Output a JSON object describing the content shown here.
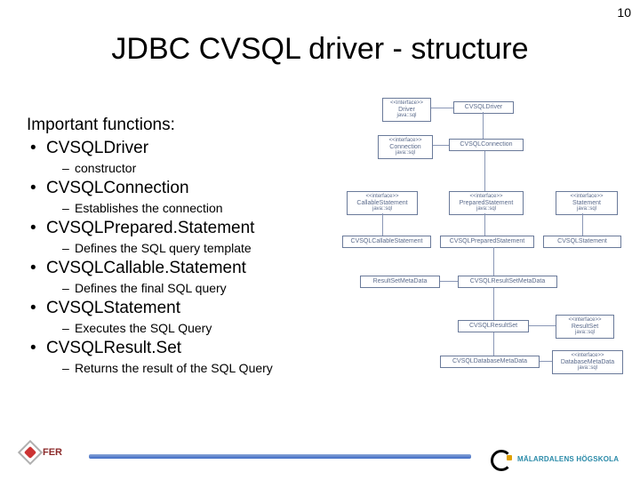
{
  "page_number": "10",
  "title": "JDBC CVSQL driver - structure",
  "intro": "Important functions:",
  "items": [
    {
      "name": "CVSQLDriver",
      "desc": "constructor"
    },
    {
      "name": "CVSQLConnection",
      "desc": "Establishes the connection"
    },
    {
      "name": "CVSQLPrepared.Statement",
      "desc": "Defines the SQL query template"
    },
    {
      "name": "CVSQLCallable.Statement",
      "desc": "Defines the final SQL query"
    },
    {
      "name": "CVSQLStatement",
      "desc": "Executes the SQL Query"
    },
    {
      "name": "CVSQLResult.Set",
      "desc": "Returns the result of the SQL Query"
    }
  ],
  "diagram": {
    "row1": [
      {
        "stereo": "<<interface>>",
        "name": "Driver",
        "sub": "java::sql"
      },
      {
        "name": "CVSQLDriver"
      }
    ],
    "row2": [
      {
        "stereo": "<<interface>>",
        "name": "Connection",
        "sub": "java::sql"
      },
      {
        "name": "CVSQLConnection"
      }
    ],
    "row3": [
      {
        "stereo": "<<interface>>",
        "name": "CallableStatement",
        "sub": "java::sql"
      },
      {
        "stereo": "<<interface>>",
        "name": "PreparedStatement",
        "sub": "java::sql"
      },
      {
        "stereo": "<<interface>>",
        "name": "Statement",
        "sub": "java::sql"
      }
    ],
    "row4": [
      {
        "name": "CVSQLCallableStatement"
      },
      {
        "name": "CVSQLPreparedStatement"
      },
      {
        "name": "CVSQLStatement"
      }
    ],
    "row5": [
      {
        "name": "ResultSetMetaData"
      },
      {
        "name": "CVSQLResultSetMetaData"
      }
    ],
    "row6": [
      {
        "name": "CVSQLResultSet"
      },
      {
        "stereo": "<<interface>>",
        "name": "ResultSet",
        "sub": "java::sql"
      }
    ],
    "row7": [
      {
        "name": "CVSQLDatabaseMetaData"
      },
      {
        "stereo": "<<interface>>",
        "name": "DatabaseMetaData",
        "sub": "java::sql"
      }
    ]
  },
  "footer": {
    "left_logo_text": "FER",
    "right_logo_text": "MÄLARDALENS HÖGSKOLA"
  }
}
